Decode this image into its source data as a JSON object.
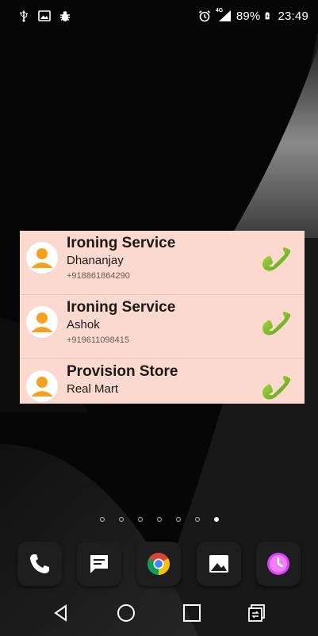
{
  "status_bar": {
    "left_icons": [
      "usb-icon",
      "image-icon",
      "bug-icon"
    ],
    "right_icons": [
      "alarm-icon",
      "signal-4g-icon",
      "battery-charging-icon"
    ],
    "network_label": "4G",
    "battery_percent": "89%",
    "time": "23:49"
  },
  "widget": {
    "accent_bg": "#fbd9cf",
    "contacts": [
      {
        "title": "Ironing Service",
        "name": "Dhananjay",
        "phone": "+918861864290"
      },
      {
        "title": "Ironing Service",
        "name": "Ashok",
        "phone": "+919611098415"
      },
      {
        "title": "Provision Store",
        "name": "Real Mart",
        "phone": ""
      }
    ]
  },
  "page_indicator": {
    "count": 7,
    "active_index": 6
  },
  "dock": {
    "apps": [
      "phone-app-icon",
      "messages-app-icon",
      "chrome-app-icon",
      "gallery-app-icon",
      "clock-app-icon"
    ]
  },
  "nav_bar": {
    "buttons": [
      "back-icon",
      "home-icon",
      "recents-icon",
      "switch-sim-icon"
    ]
  }
}
